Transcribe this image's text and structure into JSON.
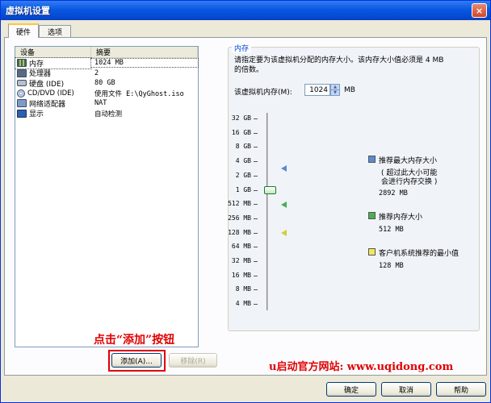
{
  "window": {
    "title": "虚拟机设置",
    "close_glyph": "×"
  },
  "tabs": [
    {
      "label": "硬件",
      "active": true
    },
    {
      "label": "选项",
      "active": false
    }
  ],
  "device_list": {
    "columns": [
      "设备",
      "摘要"
    ],
    "rows": [
      {
        "device": "内存",
        "summary": "1024 MB",
        "icon": "memory-icon",
        "selected": true
      },
      {
        "device": "处理器",
        "summary": "2",
        "icon": "processor-icon"
      },
      {
        "device": "硬盘 (IDE)",
        "summary": "80 GB",
        "icon": "harddisk-icon"
      },
      {
        "device": "CD/DVD (IDE)",
        "summary": "使用文件 E:\\QyGhost.iso",
        "icon": "cdrom-icon"
      },
      {
        "device": "网络适配器",
        "summary": "NAT",
        "icon": "network-adapter-icon"
      },
      {
        "device": "显示",
        "summary": "自动检测",
        "icon": "display-icon"
      }
    ]
  },
  "buttons": {
    "add": "添加(A)...",
    "remove": "移除(R)",
    "ok": "确定",
    "cancel": "取消",
    "help": "帮助"
  },
  "annotations": {
    "click_add": "点击“添加”按钮",
    "site": "u启动官方网站: www.uqidong.com",
    "highlight_color": "#e00000"
  },
  "memory_panel": {
    "legend": "内存",
    "description_line1": "请指定要为该虚拟机分配的内存大小。该内存大小值必须是 4 MB",
    "description_line2": "的倍数。",
    "label": "该虚拟机内存(M):",
    "value": "1024",
    "unit": "MB",
    "scale_labels": [
      "32 GB",
      "16 GB",
      "8 GB",
      "4 GB",
      "2 GB",
      "1 GB",
      "512 MB",
      "256 MB",
      "128 MB",
      "64 MB",
      "32 MB",
      "16 MB",
      "8 MB",
      "4 MB"
    ],
    "current_mb": 1024,
    "legend_items": [
      {
        "color": "#5b8ad1",
        "label": "推荐最大内存大小",
        "note_line1": "( 超过此大小可能",
        "note_line2": "会进行内存交换 )",
        "value": "2892 MB"
      },
      {
        "color": "#4caf50",
        "label": "推荐内存大小",
        "value": "512 MB"
      },
      {
        "color": "#f3e85a",
        "label": "客户机系统推荐的最小值",
        "value": "128 MB"
      }
    ]
  }
}
